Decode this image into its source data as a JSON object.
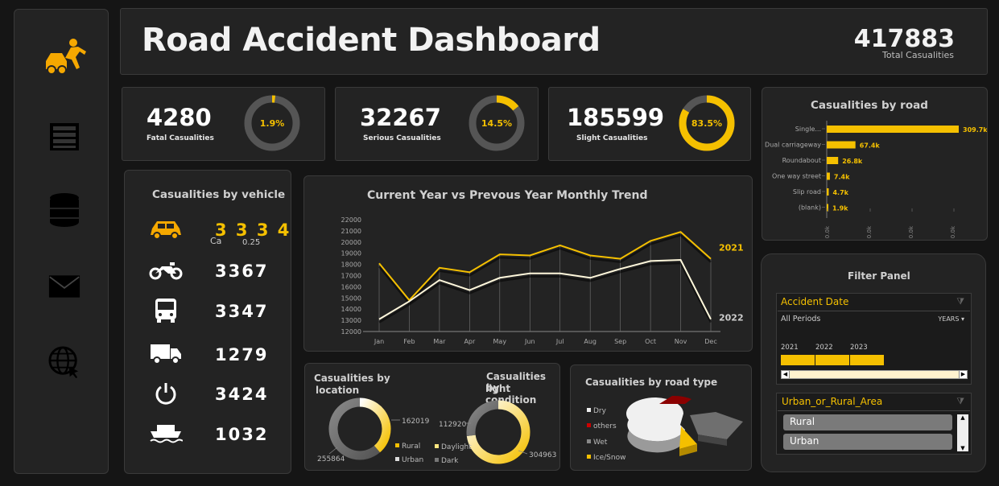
{
  "header": {
    "title": "Road Accident Dashboard",
    "total_value": "417883",
    "total_label": "Total Casualities"
  },
  "sidebar": {
    "icons": [
      "car-crash-icon",
      "dashboard-icon",
      "database-icon",
      "mail-icon",
      "web-icon"
    ]
  },
  "kpis": [
    {
      "value": "4280",
      "label": "Fatal Casualities",
      "pct": "1.9%",
      "fraction": 0.019
    },
    {
      "value": "32267",
      "label": "Serious Casualities",
      "pct": "14.5%",
      "fraction": 0.145
    },
    {
      "value": "185599",
      "label": "Slight Casualities",
      "pct": "83.5%",
      "fraction": 0.835
    }
  ],
  "vehicle": {
    "title": "Casualities by vehicle",
    "items": [
      {
        "icon": "car-icon",
        "value": "3334",
        "value_text": "3 3 3 4",
        "sub1": "Ca",
        "sub2": "0.25"
      },
      {
        "icon": "motorbike-icon",
        "value": "3367"
      },
      {
        "icon": "bus-icon",
        "value": "3347"
      },
      {
        "icon": "truck-icon",
        "value": "1279"
      },
      {
        "icon": "power-icon",
        "value": "3424"
      },
      {
        "icon": "boat-icon",
        "value": "1032"
      }
    ]
  },
  "trend": {
    "title": "Current Year vs Prevous Year Monthly Trend",
    "chart_data": {
      "type": "line",
      "title": "Current Year vs Prevous Year Monthly Trend",
      "categories": [
        "Jan",
        "Feb",
        "Mar",
        "Apr",
        "May",
        "Jun",
        "Jul",
        "Aug",
        "Sep",
        "Oct",
        "Nov",
        "Dec"
      ],
      "series": [
        {
          "name": "2021",
          "color": "#f5c000",
          "values": [
            18100,
            14800,
            17700,
            17300,
            18900,
            18800,
            19700,
            18800,
            18500,
            20100,
            20900,
            18500
          ]
        },
        {
          "name": "2022",
          "color": "#fff8dc",
          "values": [
            13100,
            14700,
            16600,
            15700,
            16800,
            17200,
            17200,
            16800,
            17600,
            18300,
            18400,
            13100
          ]
        }
      ],
      "ylim": [
        12000,
        22000
      ],
      "yticks": [
        "12000",
        "13000",
        "14000",
        "15000",
        "16000",
        "17000",
        "18000",
        "19000",
        "20000",
        "21000",
        "22000"
      ]
    }
  },
  "road": {
    "title": "Casualities by road",
    "chart_data": {
      "type": "bar",
      "categories": [
        "Single...",
        "Dual carriageway",
        "Roundabout",
        "One way street",
        "Slip road",
        "(blank)"
      ],
      "values": [
        309.7,
        67.4,
        26.8,
        7.4,
        4.7,
        1.9
      ],
      "labels": [
        "309.7k",
        "67.4k",
        "26.8k",
        "7.4k",
        "4.7k",
        "1.9k"
      ],
      "xticks": [
        "0.0k",
        "0.0k",
        "0.0k",
        "0.0k"
      ],
      "color": "#f5c000"
    }
  },
  "location": {
    "title_line1": "Casualities by",
    "title_line2": "location",
    "chart_data": {
      "type": "pie",
      "categories": [
        "Rural",
        "Urban"
      ],
      "values": [
        162019,
        255864
      ],
      "labels": [
        "162019",
        "255864"
      ]
    }
  },
  "light": {
    "title_line1": "Casualities by",
    "title_line2": "light condition",
    "chart_data": {
      "type": "pie",
      "categories": [
        "Daylight",
        "Dark"
      ],
      "values": [
        304963,
        112920
      ],
      "labels": [
        "304963",
        "112920"
      ]
    }
  },
  "road_type": {
    "title": "Casualities by road type",
    "chart_data": {
      "type": "pie",
      "categories": [
        "Dry",
        "others",
        "Wet",
        "Ice/Snow"
      ],
      "colors": [
        "#eeeeee",
        "#cc0000",
        "#888888",
        "#f5c000"
      ]
    }
  },
  "filter": {
    "title": "Filter Panel",
    "date_slicer": {
      "title": "Accident Date",
      "period": "All Periods",
      "unit": "YEARS",
      "years": [
        "2021",
        "2022",
        "2023"
      ]
    },
    "area_slicer": {
      "title": "Urban_or_Rural_Area",
      "items": [
        "Rural",
        "Urban"
      ]
    }
  },
  "colors": {
    "accent": "#f5c000",
    "panel": "#232323",
    "background": "#151515"
  }
}
